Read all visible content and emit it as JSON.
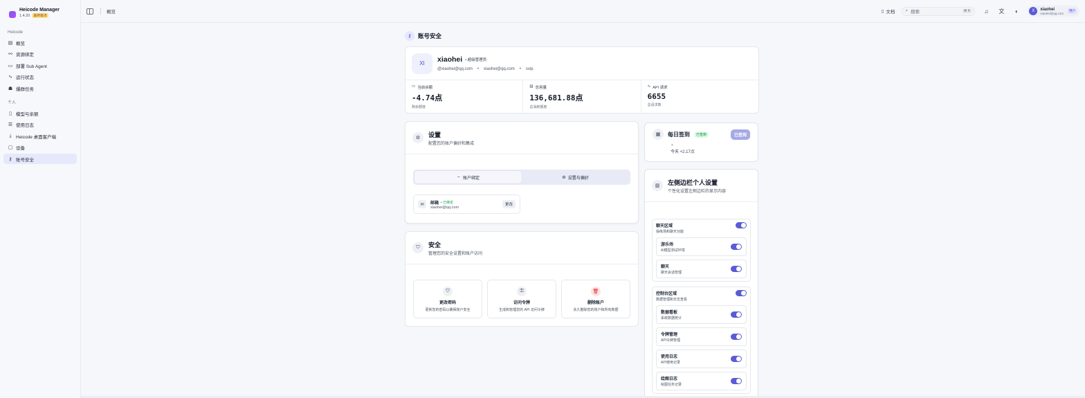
{
  "sidebar": {
    "brand_title": "Heicode Manager",
    "brand_version": "1.4.20",
    "brand_badge": "最新版本",
    "group1": "Heicode",
    "items1": [
      {
        "label": "概览",
        "icon": "dashboard-icon"
      },
      {
        "label": "资源绑定",
        "icon": "link-icon"
      },
      {
        "label": "部署 Sub Agent",
        "icon": "server-icon"
      },
      {
        "label": "运行状态",
        "icon": "activity-icon"
      },
      {
        "label": "爆群任务",
        "icon": "tasks-icon"
      }
    ],
    "group2": "个人",
    "items2": [
      {
        "label": "模型与余额",
        "icon": "book-icon"
      },
      {
        "label": "使用日志",
        "icon": "list-icon"
      },
      {
        "label": "Heicode 桌面客户端",
        "icon": "download-icon"
      },
      {
        "label": "设备",
        "icon": "device-icon"
      },
      {
        "label": "账号安全",
        "icon": "user-lock-icon"
      }
    ]
  },
  "topbar": {
    "breadcrumb": "概览",
    "docs_label": "文档",
    "search_placeholder": "搜索",
    "search_shortcut": "⌘ K",
    "user": {
      "initial": "X",
      "name": "xiaohei",
      "email": "xiaohei@qq.com",
      "badge": "用户"
    }
  },
  "page": {
    "title": "账号安全"
  },
  "profile": {
    "initials": "XI",
    "name": "xiaohei",
    "role": "超级管理员",
    "email_at": "@xiaohei@qq.com",
    "email": "xiaohei@qq.com",
    "plan": "svip",
    "stats": [
      {
        "label": "当前余额",
        "value": "-4.74点",
        "sub": "剩余额度"
      },
      {
        "label": "总用量",
        "value": "136,681.88点",
        "sub": "总消耗额度"
      },
      {
        "label": "API 请求",
        "value": "6655",
        "sub": "总请求数"
      }
    ]
  },
  "settings": {
    "title": "设置",
    "desc": "配置您的账户偏好和集成",
    "tab1": "账户绑定",
    "tab2": "设置与偏好",
    "email_title": "邮箱",
    "email_status": "已绑定",
    "email_value": "xiaohei@qq.com",
    "change_btn": "更改"
  },
  "security": {
    "title": "安全",
    "desc": "管理您的安全设置和账户访问",
    "actions": [
      {
        "title": "更改密码",
        "desc": "更新您的密码以确保账户安全",
        "icon": "shield-icon"
      },
      {
        "title": "访问令牌",
        "desc": "生成和管理您的 API 访问令牌",
        "icon": "key-icon"
      },
      {
        "title": "删除账户",
        "desc": "永久删除您的账户和所有数据",
        "icon": "trash-icon"
      }
    ]
  },
  "checkin": {
    "title": "每日签到",
    "badge": "已签到",
    "button": "已签到",
    "chevron": "⌄",
    "today": "今天 +2.17点"
  },
  "leftbar_settings": {
    "title": "左侧边栏个人设置",
    "desc": "个性化设置左侧边栏的显示内容",
    "groups": [
      {
        "title": "聊天区域",
        "desc": "操练场和聊天功能",
        "enabled": true,
        "items": [
          {
            "title": "游乐场",
            "desc": "AI模型测试环境",
            "enabled": true
          },
          {
            "title": "聊天",
            "desc": "聊天会话管理",
            "enabled": true
          }
        ]
      },
      {
        "title": "控制台区域",
        "desc": "数据管理和日志查看",
        "enabled": true,
        "items": [
          {
            "title": "数据看板",
            "desc": "系统数据统计",
            "enabled": true
          },
          {
            "title": "令牌管理",
            "desc": "API令牌管理",
            "enabled": true
          },
          {
            "title": "使用日志",
            "desc": "API使用记录",
            "enabled": true
          },
          {
            "title": "绘图日志",
            "desc": "绘图任务记录",
            "enabled": true
          }
        ]
      }
    ]
  },
  "colors": {
    "accent": "#5b5bd6",
    "success": "#16a34a",
    "danger": "#dc2626"
  }
}
